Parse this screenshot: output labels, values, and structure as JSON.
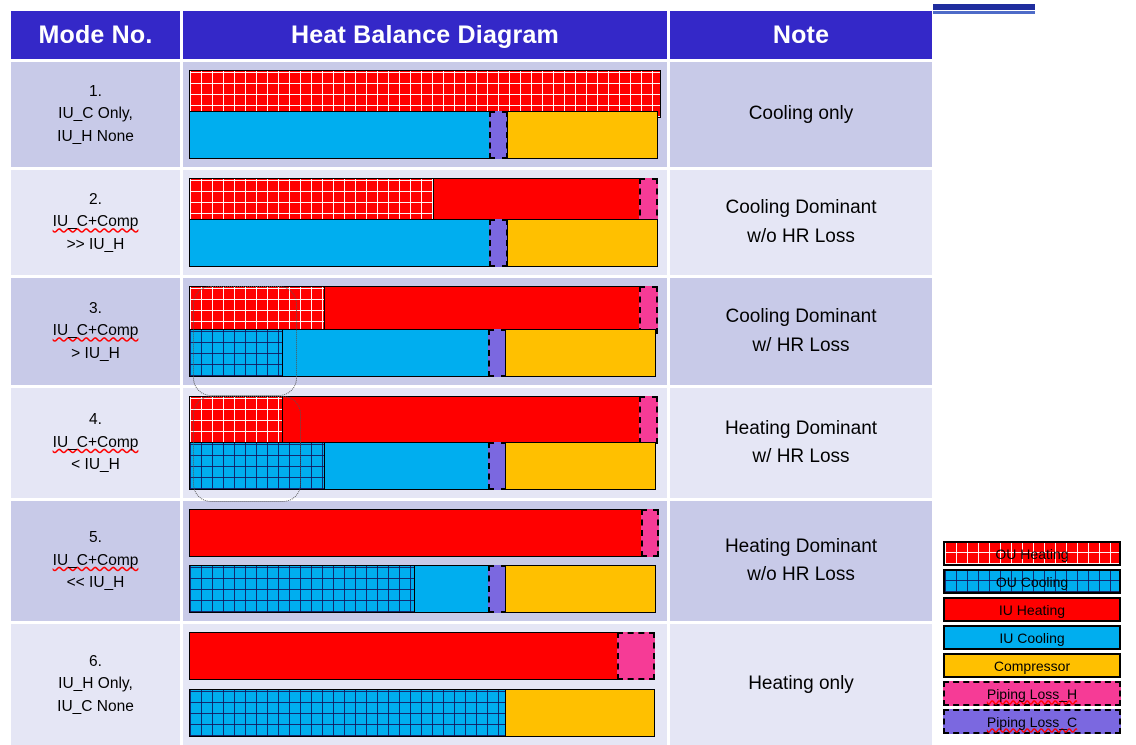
{
  "table": {
    "headers": [
      {
        "id": "mode-no",
        "label": "Mode No."
      },
      {
        "id": "heat-balance-diagram",
        "label": "Heat Balance Diagram"
      },
      {
        "id": "note",
        "label": "Note"
      }
    ],
    "rows": [
      {
        "mode_line1": "1.",
        "mode_line2": "IU_C Only,",
        "mode_line3": "IU_H None",
        "mode_spell": false,
        "note": "Cooling only",
        "tone": "a"
      },
      {
        "mode_line1": "2.",
        "mode_line2": "IU_C+Comp",
        "mode_line3": ">> IU_H",
        "mode_spell": true,
        "note": "Cooling Dominant\nw/o HR Loss",
        "tone": "b"
      },
      {
        "mode_line1": "3.",
        "mode_line2": "IU_C+Comp",
        "mode_line3": "> IU_H",
        "mode_spell": true,
        "note": "Cooling Dominant\nw/ HR Loss",
        "tone": "a"
      },
      {
        "mode_line1": "4.",
        "mode_line2": "IU_C+Comp",
        "mode_line3": "< IU_H",
        "mode_spell": true,
        "note": "Heating Dominant\nw/ HR Loss",
        "tone": "b"
      },
      {
        "mode_line1": "5.",
        "mode_line2": "IU_C+Comp",
        "mode_line3": "<< IU_H",
        "mode_spell": true,
        "note": "Heating Dominant\nw/o HR Loss",
        "tone": "a"
      },
      {
        "mode_line1": "6.",
        "mode_line2": "IU_H Only,",
        "mode_line3": "IU_C None",
        "mode_spell": false,
        "note": "Heating only",
        "tone": "b"
      }
    ]
  },
  "chart_data": {
    "type": "bar",
    "title": "Heat Balance Diagram",
    "orientation": "horizontal-stacked",
    "unit": "percent of full-scale bar width",
    "xlim": [
      0,
      100
    ],
    "categories": [
      "1",
      "2",
      "3",
      "4",
      "5",
      "6"
    ],
    "segment_types": {
      "OU Heating": "#FF0000 hatched",
      "OU Cooling": "#00AEEF hatched",
      "IU Heating": "#FF0000",
      "IU Cooling": "#00AEEF",
      "Compressor": "#FFC000",
      "Piping Loss_H": "#F63B96",
      "Piping Loss_C": "#7B68E0"
    },
    "rows": [
      {
        "mode": "1",
        "total_width_pct": 100,
        "top_bar": [
          {
            "name": "OU Heating",
            "value": 100
          }
        ],
        "bottom_bar": [
          {
            "name": "IU Cooling",
            "value": 64
          },
          {
            "name": "Piping Loss_C",
            "value": 4
          },
          {
            "name": "Compressor",
            "value": 32
          }
        ]
      },
      {
        "mode": "2",
        "total_width_pct": 100,
        "top_bar": [
          {
            "name": "OU Heating",
            "value": 52
          },
          {
            "name": "IU Heating",
            "value": 44
          },
          {
            "name": "Piping Loss_H",
            "value": 4
          }
        ],
        "bottom_bar": [
          {
            "name": "IU Cooling",
            "value": 64
          },
          {
            "name": "Piping Loss_C",
            "value": 4
          },
          {
            "name": "Compressor",
            "value": 32
          }
        ]
      },
      {
        "mode": "3",
        "total_width_pct": 100,
        "top_bar": [
          {
            "name": "OU Heating",
            "value": 29
          },
          {
            "name": "IU Heating",
            "value": 67
          },
          {
            "name": "Piping Loss_H",
            "value": 4
          }
        ],
        "bottom_bar": [
          {
            "name": "OU Cooling",
            "value": 20
          },
          {
            "name": "IU Cooling",
            "value": 44
          },
          {
            "name": "Piping Loss_C",
            "value": 4
          },
          {
            "name": "Compressor",
            "value": 32
          }
        ]
      },
      {
        "mode": "4",
        "total_width_pct": 100,
        "top_bar": [
          {
            "name": "OU Heating",
            "value": 20
          },
          {
            "name": "IU Heating",
            "value": 76
          },
          {
            "name": "Piping Loss_H",
            "value": 4
          }
        ],
        "bottom_bar": [
          {
            "name": "OU Cooling",
            "value": 29
          },
          {
            "name": "IU Cooling",
            "value": 35
          },
          {
            "name": "Piping Loss_C",
            "value": 4
          },
          {
            "name": "Compressor",
            "value": 32
          }
        ]
      },
      {
        "mode": "5",
        "total_width_pct": 100,
        "top_bar": [
          {
            "name": "IU Heating",
            "value": 96
          },
          {
            "name": "Piping Loss_H",
            "value": 4
          }
        ],
        "bottom_bar": [
          {
            "name": "OU Cooling",
            "value": 48
          },
          {
            "name": "IU Cooling",
            "value": 16
          },
          {
            "name": "Piping Loss_C",
            "value": 4
          },
          {
            "name": "Compressor",
            "value": 32
          }
        ]
      },
      {
        "mode": "6",
        "total_width_pct": 99,
        "top_bar": [
          {
            "name": "IU Heating",
            "value": 92
          },
          {
            "name": "Piping Loss_H",
            "value": 8
          }
        ],
        "bottom_bar": [
          {
            "name": "OU Cooling",
            "value": 68
          },
          {
            "name": "Compressor",
            "value": 32
          }
        ]
      }
    ],
    "annotations": [
      {
        "name": "hr-loss-callout-mode3",
        "shape": "rounded-dotted-rectangle",
        "target": "mode 3 OU segments"
      },
      {
        "name": "hr-loss-callout-mode4",
        "shape": "rounded-dotted-rectangle",
        "target": "mode 4 OU segments"
      }
    ]
  },
  "legend": {
    "items": [
      {
        "label": "OU Heating",
        "style": "ou-heating",
        "dashed": false,
        "spell": false
      },
      {
        "label": "OU Cooling",
        "style": "ou-cooling",
        "dashed": false,
        "spell": false
      },
      {
        "label": "IU Heating",
        "style": "iu-heating",
        "dashed": false,
        "spell": false
      },
      {
        "label": "IU Cooling",
        "style": "iu-cooling",
        "dashed": false,
        "spell": false
      },
      {
        "label": "Compressor",
        "style": "compressor",
        "dashed": false,
        "spell": false
      },
      {
        "label": "Piping Loss_H",
        "style": "piping-loss-h",
        "dashed": true,
        "spell": true
      },
      {
        "label": "Piping Loss_C",
        "style": "piping-loss-c",
        "dashed": true,
        "spell": true
      }
    ]
  },
  "colors": {
    "header_blue": "#3428C8",
    "row_tone_a": "#C8CAE8",
    "row_tone_b": "#E5E6F5",
    "iu_heating": "#FF0000",
    "iu_cooling": "#00AEEF",
    "compressor": "#FFC000",
    "piping_loss_h": "#F63B96",
    "piping_loss_c": "#7B68E0"
  }
}
